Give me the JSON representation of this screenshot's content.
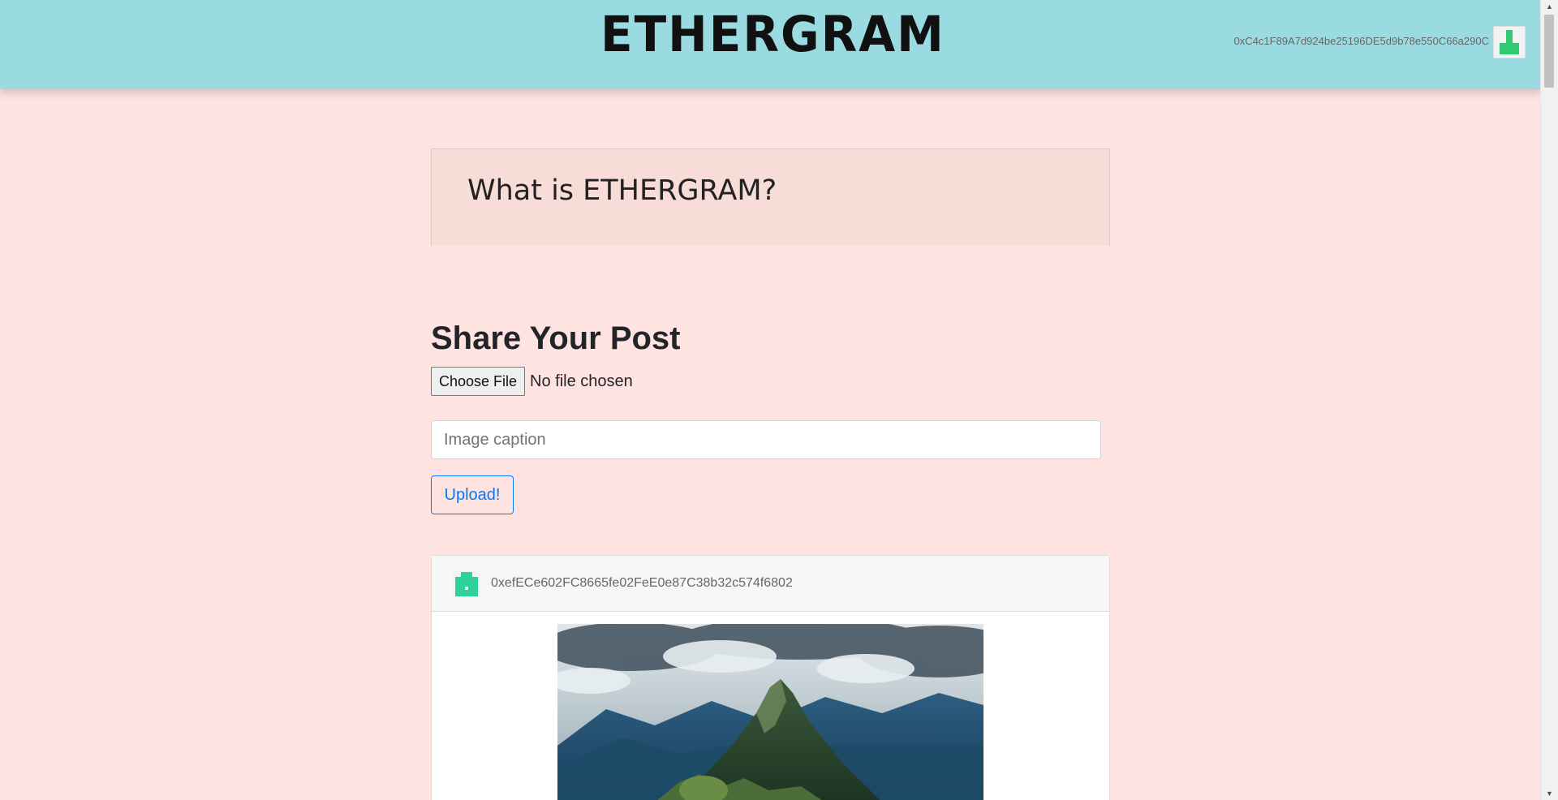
{
  "navbar": {
    "brand": "ETHERGRAM",
    "account": "0xC4c1F89A7d924be25196DE5d9b78e550C66a290C",
    "avatar_icon": "identicon-icon",
    "colors": {
      "background": "#9adbe2",
      "identicon": "#2ecc71"
    }
  },
  "jumbotron": {
    "title": "What is ETHERGRAM?"
  },
  "share": {
    "title": "Share Your Post",
    "choose_file_label": "Choose File",
    "file_status": "No file chosen",
    "caption_placeholder": "Image caption",
    "caption_value": "",
    "upload_label": "Upload!"
  },
  "posts": [
    {
      "author": "0xefECe602FC8665fe02FeE0e87C38b32c574f6802",
      "avatar_icon": "identicon-icon",
      "avatar_color": "#2bd39b",
      "image": "mountain-landscape-image"
    }
  ],
  "colors": {
    "page_background": "#ffe3e0",
    "primary": "#007bff"
  }
}
